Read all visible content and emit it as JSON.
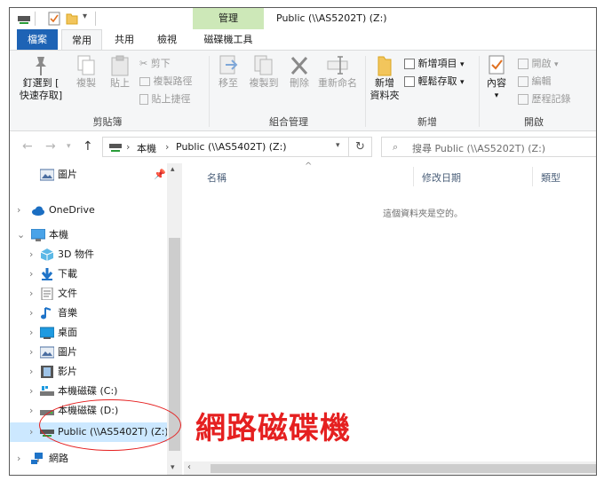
{
  "window": {
    "title": "Public (\\\\AS5202T) (Z:)",
    "context_tab_group": "管理"
  },
  "tabs": [
    "檔案",
    "常用",
    "共用",
    "檢視",
    "磁碟機工具"
  ],
  "ribbon": {
    "clipboard": {
      "label": "剪貼簿",
      "pin": "釘選到 [\n快速存取]",
      "copy": "複製",
      "paste": "貼上",
      "cut": "剪下",
      "copy_path": "複製路徑",
      "paste_shortcut": "貼上捷徑"
    },
    "organize": {
      "label": "組合管理",
      "move_to": "移至",
      "copy_to": "複製到",
      "delete": "刪除",
      "rename": "重新命名"
    },
    "new": {
      "label": "新增",
      "new_folder": "新增\n資料夾",
      "new_item": "新增項目",
      "easy_access": "輕鬆存取"
    },
    "open": {
      "label": "開啟",
      "properties": "內容",
      "open": "開啟",
      "edit": "編輯",
      "history": "歷程記錄"
    }
  },
  "address": {
    "crumbs": [
      "本機",
      "Public (\\\\AS5402T) (Z:)"
    ],
    "search_placeholder": "搜尋 Public (\\\\AS5202T) (Z:)"
  },
  "nav_pane": {
    "items": [
      {
        "label": "圖片",
        "icon": "pictures-icon",
        "pinned": true
      },
      {
        "label": "OneDrive",
        "icon": "onedrive-icon"
      },
      {
        "label": "本機",
        "icon": "this-pc-icon",
        "expanded": true
      },
      {
        "label": "3D 物件",
        "icon": "3d-objects-icon"
      },
      {
        "label": "下載",
        "icon": "downloads-icon"
      },
      {
        "label": "文件",
        "icon": "documents-icon"
      },
      {
        "label": "音樂",
        "icon": "music-icon"
      },
      {
        "label": "桌面",
        "icon": "desktop-icon"
      },
      {
        "label": "圖片",
        "icon": "pictures-icon"
      },
      {
        "label": "影片",
        "icon": "videos-icon"
      },
      {
        "label": "本機磁碟 (C:)",
        "icon": "local-disk-icon"
      },
      {
        "label": "本機磁碟 (D:)",
        "icon": "local-disk-icon"
      },
      {
        "label": "Public (\\\\AS5402T) (Z:)",
        "icon": "network-drive-icon"
      },
      {
        "label": "網路",
        "icon": "network-icon"
      }
    ]
  },
  "content": {
    "columns": [
      "名稱",
      "修改日期",
      "類型"
    ],
    "empty_message": "這個資料夾是空的。"
  },
  "annotation": {
    "text": "網路磁碟機"
  },
  "colors": {
    "file_tab": "#1e63b5",
    "context_tab": "#cde8b8",
    "annotation": "#e52020"
  }
}
